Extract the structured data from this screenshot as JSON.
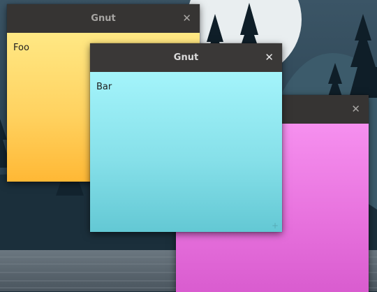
{
  "desktop": {
    "wallpaper": "mountain-lake-night",
    "colors": {
      "sky": "#2a4455",
      "moon": "#e9eef0",
      "water": "#55606a"
    }
  },
  "notes": [
    {
      "id": "foo",
      "title": "Gnut",
      "text": "Foo",
      "color": "#ffd260",
      "active": false,
      "close_icon": "close-icon"
    },
    {
      "id": "pink",
      "title": "",
      "text": "",
      "color": "#e873de",
      "active": false,
      "close_icon": "close-icon"
    },
    {
      "id": "bar",
      "title": "Gnut",
      "text": "Bar",
      "color": "#86e0e9",
      "active": true,
      "close_icon": "close-icon",
      "resize_icon": "resize-grip-icon"
    }
  ]
}
